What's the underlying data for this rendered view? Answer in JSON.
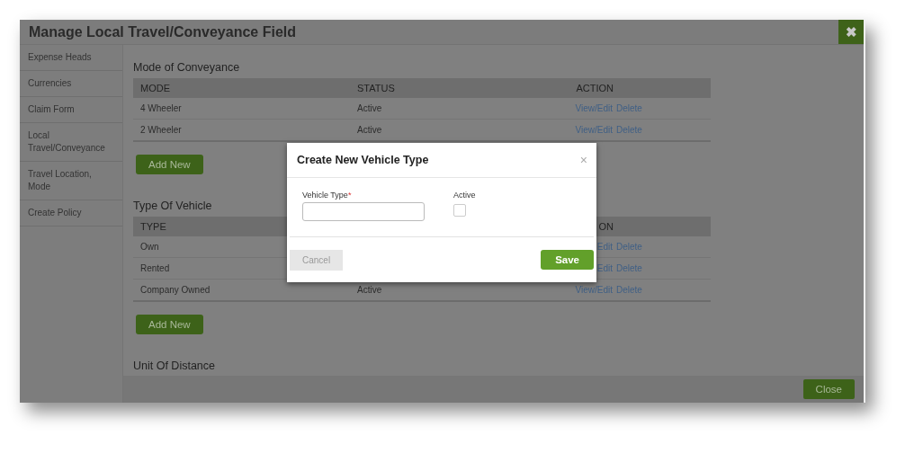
{
  "window": {
    "title": "Manage Local Travel/Conveyance Field",
    "close_icon": "✖"
  },
  "sidebar": {
    "items": [
      {
        "label": "Expense Heads"
      },
      {
        "label": "Currencies"
      },
      {
        "label": "Claim Form"
      },
      {
        "label": "Local Travel/Conveyance"
      },
      {
        "label": "Travel Location, Mode"
      },
      {
        "label": "Create Policy"
      }
    ]
  },
  "sections": [
    {
      "title": "Mode of Conveyance",
      "columns": [
        {
          "label": "MODE"
        },
        {
          "label": "STATUS"
        },
        {
          "label": "ACTION"
        }
      ],
      "rows": [
        {
          "name": "4 Wheeler",
          "status": "Active",
          "view": "View/Edit",
          "delete": "Delete"
        },
        {
          "name": "2 Wheeler",
          "status": "Active",
          "view": "View/Edit",
          "delete": "Delete"
        }
      ],
      "add_button": "Add New"
    },
    {
      "title": "Type Of Vehicle",
      "columns": [
        {
          "label": "TYPE"
        },
        {},
        {
          "label": "ON"
        }
      ],
      "rows": [
        {
          "name": "Own",
          "view": "Edit",
          "delete": "Delete"
        },
        {
          "name": "Rented",
          "view": "Edit",
          "delete": "Delete"
        },
        {
          "name": "Company Owned",
          "status": "Active",
          "view": "View/Edit",
          "delete": "Delete"
        }
      ],
      "add_button": "Add New"
    },
    {
      "title": "Unit Of Distance"
    }
  ],
  "footer": {
    "close_button": "Close"
  },
  "modal": {
    "title": "Create New Vehicle Type",
    "close": "×",
    "field": {
      "label": "Vehicle Type",
      "required_mark": "*"
    },
    "active": {
      "label": "Active",
      "checked": false
    },
    "cancel_button": "Cancel",
    "save_button": "Save"
  }
}
